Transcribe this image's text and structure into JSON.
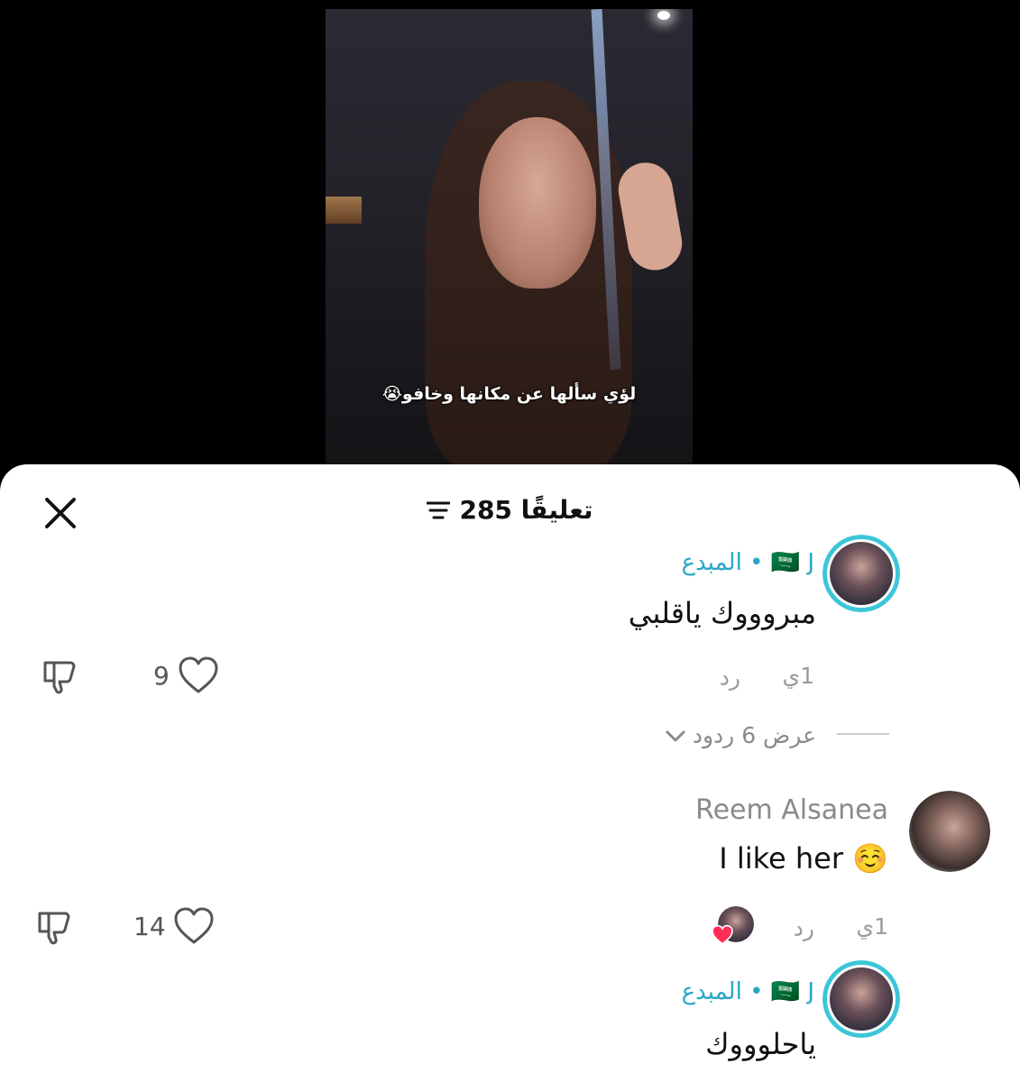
{
  "video": {
    "caption": "لؤي سألها عن مكانها وخافو😭"
  },
  "header": {
    "count": "285",
    "label": "تعليقًا"
  },
  "comments": [
    {
      "author": "J • المبدع",
      "flag": "🇸🇦",
      "text": "مبروووك ياقلبي",
      "time": "1ي",
      "reply_label": "رد",
      "likes": "9",
      "view_replies": "عرض 6 ردود"
    },
    {
      "author": "Reem Alsanea",
      "text": "I like her ☺️",
      "time": "1ي",
      "reply_label": "رد",
      "likes": "14"
    },
    {
      "author": "J • المبدع",
      "flag": "🇸🇦",
      "text": "ياحلوووك"
    }
  ]
}
